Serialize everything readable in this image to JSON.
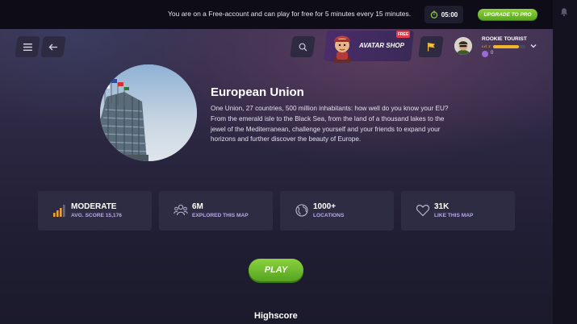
{
  "banner": {
    "message": "You are on a Free-account and can play for free for 5 minutes every 15 minutes.",
    "timer": "05:00",
    "upgrade_label": "UPGRADE TO PRO"
  },
  "header": {
    "avatar_shop_label": "AVATAR SHOP",
    "free_badge": "FREE",
    "user": {
      "name": "ROOKIE TOURIST",
      "level": "Lvl. 2",
      "xp_progress": 0.8,
      "coins": "0"
    }
  },
  "map": {
    "title": "European Union",
    "description": "One Union, 27 countries, 500 million inhabitants: how well do you know your EU? From the emerald isle to the Black Sea, from the land of a thousand lakes to the jewel of the Mediterranean, challenge yourself and your friends to expand your horizons and further discover the beauty of Europe."
  },
  "stats": [
    {
      "value": "MODERATE",
      "sub": "AVG. SCORE 15,176",
      "icon": "difficulty-bars-icon"
    },
    {
      "value": "6M",
      "sub": "EXPLORED THIS MAP",
      "icon": "people-icon"
    },
    {
      "value": "1000+",
      "sub": "LOCATIONS",
      "icon": "globe-icon"
    },
    {
      "value": "31K",
      "sub": "LIKE THIS MAP",
      "icon": "heart-icon"
    }
  ],
  "play_label": "PLAY",
  "highscore_label": "Highscore",
  "colors": {
    "accent_green": "#6bbf2a",
    "stat_label": "#b9a9e6",
    "card_bg": "#2e2c42",
    "free_badge": "#e23b4a"
  }
}
